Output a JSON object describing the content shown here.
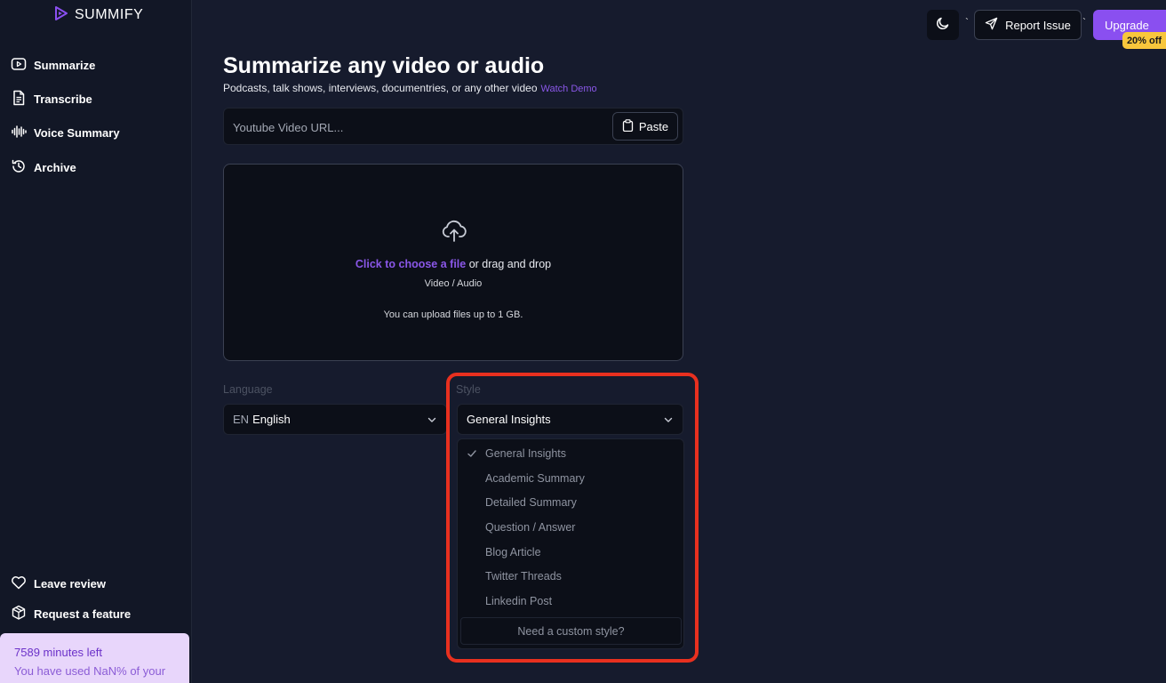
{
  "app": {
    "logo_text": "SUMMIFY",
    "accent_color": "#8a4ff0"
  },
  "sidebar": {
    "items": [
      {
        "label": "Summarize",
        "icon": "play-square-icon"
      },
      {
        "label": "Transcribe",
        "icon": "document-icon"
      },
      {
        "label": "Voice Summary",
        "icon": "audio-waveform-icon"
      },
      {
        "label": "Archive",
        "icon": "history-icon"
      }
    ],
    "bottom_items": [
      {
        "label": "Leave review",
        "icon": "heart-icon"
      },
      {
        "label": "Request a feature",
        "icon": "package-icon"
      }
    ],
    "usage": {
      "minutes_left": "7589 minutes left",
      "used_text": "You have used NaN% of your"
    }
  },
  "topbar": {
    "theme_icon": "moon-icon",
    "report_label": "Report Issue",
    "upgrade_label": "Upgrade",
    "discount_label": "20% off",
    "tick": "`"
  },
  "main": {
    "title": "Summarize any video or audio",
    "subtitle": "Podcasts, talk shows, interviews, documentries, or any other video",
    "watch_demo": "Watch Demo",
    "url_placeholder": "Youtube Video URL...",
    "paste_label": "Paste",
    "dropzone": {
      "link_text": "Click to choose a file",
      "rest_text": " or drag and drop",
      "types": "Video / Audio",
      "limit": "You can upload files up to 1 GB."
    },
    "language": {
      "label": "Language",
      "code": "EN",
      "value": "English"
    },
    "style": {
      "label": "Style",
      "value": "General Insights",
      "options": [
        "General Insights",
        "Academic Summary",
        "Detailed Summary",
        "Question / Answer",
        "Blog Article",
        "Twitter Threads",
        "Linkedin Post"
      ],
      "selected_index": 0,
      "custom_label": "Need a custom style?"
    }
  },
  "annotation_color": "#e8301f"
}
